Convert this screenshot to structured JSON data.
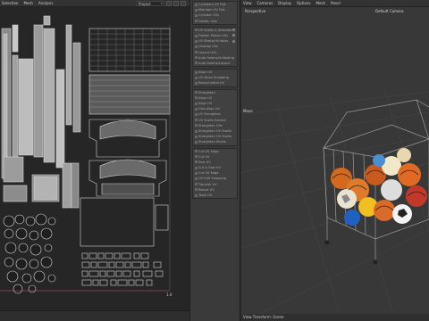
{
  "uv_editor": {
    "menu": [
      "Selection",
      "Mesh",
      "Analysis"
    ],
    "dropdown_value": "Project",
    "corner_value": "1.0"
  },
  "tool_panel": {
    "sections": [
      [
        "Cylinders UV Flat",
        "Maintain UV Flat",
        "Cylinder UVs",
        "Flatten UVs"
      ],
      [
        "UV Shells & Selections",
        "Flatten Planar UVs",
        "UV Master/Unfolds",
        "Unwrap UVs",
        "Layout UVs",
        "Auto Seams/Unfolding",
        "Auto Seams/Layout"
      ],
      [
        "Align UV",
        "UV Move Snapping",
        "Relax/Unfold UV"
      ],
      [
        "Straighten",
        "Align UV",
        "Align UV",
        "Grid Align UV",
        "UV Straighten",
        "UV Shells Extract",
        "Straighten UVs",
        "Straighten UV Shells",
        "Straighten UV Shells",
        "Straighten Shells"
      ],
      [
        "Cut UV Edge",
        "Cut UV",
        "Sew UV",
        "Cut & Sew UV",
        "Cut UV Edge",
        "UV Edit Snapping",
        "Transfer UV",
        "Resize UV",
        "Texel UV"
      ]
    ]
  },
  "viewport": {
    "menu": [
      "View",
      "Cameras",
      "Display",
      "Options",
      "Mesh",
      "Panel"
    ],
    "camera_label": "Perspective",
    "default_camera": "Default Camera",
    "move_label": "Move",
    "footer_text": "View Transform: Scene"
  },
  "colors": {
    "uv_bg": "#262626",
    "viewport_bg": "#383838",
    "uv_lines": "#d9d9d9",
    "panel_bg": "#3a3a3a"
  }
}
